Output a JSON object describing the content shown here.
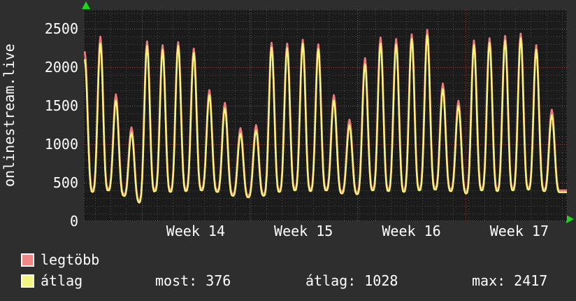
{
  "window": {
    "vertical_title": "onlinestream.live"
  },
  "colors": {
    "background": "#2e2e2e",
    "plot_background": "#1b1b1b",
    "grid_minor": "#4e4e4e",
    "grid_major": "#b23a3a",
    "text": "#ffffff",
    "arrow": "#1ed41e",
    "series_max_line": "#ee7b7b",
    "series_avg_line": "#f6f67c",
    "legend_swatch_max": "#f08888",
    "legend_swatch_avg": "#f5f584"
  },
  "legend": {
    "items": [
      {
        "label": "legtöbb",
        "swatch_color": "#f08888"
      },
      {
        "label": "átlag",
        "swatch_color": "#f5f584"
      }
    ]
  },
  "stats": {
    "items": [
      {
        "label": "most:",
        "value": "376"
      },
      {
        "label": "átlag:",
        "value": "1028"
      },
      {
        "label": "max:",
        "value": "2417"
      }
    ]
  },
  "chart_data": {
    "type": "line",
    "title": "onlinestream.live",
    "xlabel": "",
    "ylabel": "",
    "x_tick_labels": [
      "Week 14",
      "Week 15",
      "Week 16",
      "Week 17"
    ],
    "y_tick_labels": [
      0,
      500,
      1000,
      1500,
      2000,
      2500
    ],
    "ylim": [
      0,
      2750
    ],
    "days": 31,
    "grid": {
      "minor_y_step": 100,
      "major_y_step": 500,
      "minor_x_step": "1 day",
      "major_x_step": "1 week",
      "style": "dotted"
    },
    "legend_position": "bottom-left",
    "series": [
      {
        "name": "legtöbb",
        "meaning": "daily maximum viewers",
        "color": "#ee7b7b",
        "trough_offset": 25,
        "day_peaks": [
          2200,
          2400,
          1650,
          1220,
          2340,
          2290,
          2330,
          2245,
          1705,
          1540,
          1210,
          1250,
          2320,
          2310,
          2360,
          2300,
          1640,
          1320,
          2120,
          2390,
          2370,
          2430,
          2490,
          1790,
          1565,
          2350,
          2380,
          2410,
          2440,
          2290,
          1450
        ]
      },
      {
        "name": "átlag",
        "meaning": "average viewers",
        "color": "#f6f67c",
        "trough_offset": 0,
        "day_peaks": [
          2100,
          2310,
          1570,
          1150,
          2280,
          2230,
          2280,
          2190,
          1640,
          1470,
          1140,
          1180,
          2260,
          2250,
          2310,
          2240,
          1570,
          1250,
          2040,
          2310,
          2300,
          2370,
          2417,
          1720,
          1500,
          2290,
          2320,
          2350,
          2380,
          2230,
          1380
        ]
      }
    ],
    "night_troughs": [
      380,
      380,
      400,
      330,
      240,
      390,
      380,
      390,
      400,
      380,
      330,
      310,
      330,
      380,
      400,
      390,
      400,
      360,
      350,
      400,
      390,
      380,
      400,
      410,
      390,
      360,
      400,
      390,
      400,
      410,
      390,
      376
    ],
    "last_value": 376,
    "average_value": 1028,
    "max_value": 2417
  }
}
